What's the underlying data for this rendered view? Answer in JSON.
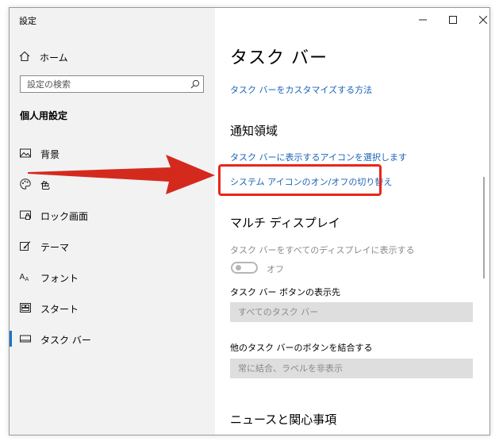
{
  "window": {
    "title": "設定",
    "controls": {
      "minimize": "—",
      "maximize": "☐",
      "close": "✕"
    }
  },
  "sidebar": {
    "home": {
      "label": "ホーム",
      "icon": "home-icon"
    },
    "search": {
      "placeholder": "設定の検索",
      "icon": "search-icon"
    },
    "section_title": "個人用設定",
    "items": [
      {
        "label": "背景",
        "icon": "picture-icon"
      },
      {
        "label": "色",
        "icon": "palette-icon"
      },
      {
        "label": "ロック画面",
        "icon": "lock-screen-icon"
      },
      {
        "label": "テーマ",
        "icon": "theme-icon"
      },
      {
        "label": "フォント",
        "icon": "font-icon"
      },
      {
        "label": "スタート",
        "icon": "start-icon"
      },
      {
        "label": "タスク バー",
        "icon": "taskbar-icon",
        "active": true
      }
    ]
  },
  "main": {
    "title": "タスク バー",
    "customize_link": "タスク バーをカスタマイズする方法",
    "notification_area": {
      "heading": "通知領域",
      "select_icons_link": "タスク バーに表示するアイコンを選択します",
      "system_icons_link": "システム アイコンのオン/オフの切り替え"
    },
    "multi_display": {
      "heading": "マルチ ディスプレイ",
      "show_on_all_label": "タスク バーをすべてのディスプレイに表示する",
      "toggle_state": "オフ",
      "show_buttons_label": "タスク バー ボタンの表示先",
      "show_buttons_value": "すべてのタスク バー",
      "combine_label": "他のタスク バーのボタンを結合する",
      "combine_value": "常に結合、ラベルを非表示"
    },
    "news_heading": "ニュースと関心事項"
  },
  "annotation": {
    "highlight_color": "#e8261a",
    "arrow_color": "#d42a1e"
  }
}
